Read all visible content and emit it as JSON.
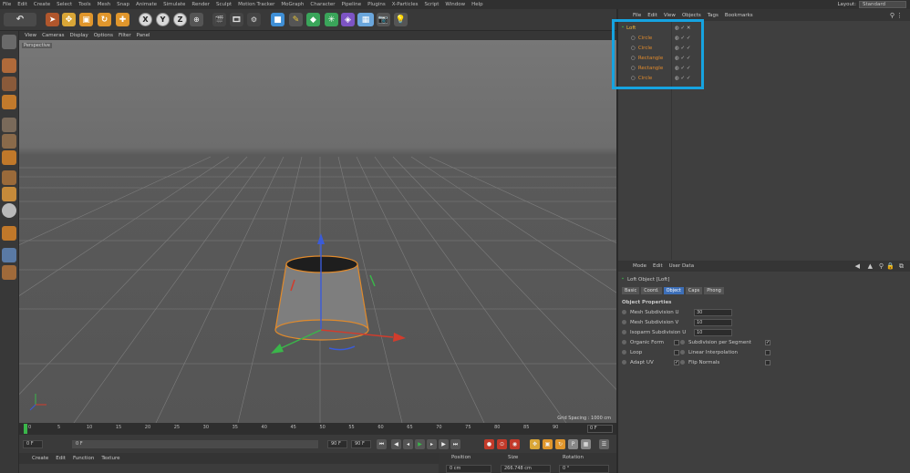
{
  "menubar": {
    "items": [
      "File",
      "Edit",
      "Create",
      "Select",
      "Tools",
      "Mesh",
      "Snap",
      "Animate",
      "Simulate",
      "Render",
      "Sculpt",
      "Motion Tracker",
      "MoGraph",
      "Character",
      "Pipeline",
      "Plugins",
      "X-Particles",
      "Script",
      "Window",
      "Help"
    ]
  },
  "layout": {
    "label": "Layout:",
    "value": "Standard"
  },
  "toolbar": {
    "axis_x": "X",
    "axis_y": "Y",
    "axis_z": "Z"
  },
  "viewport": {
    "menu": [
      "View",
      "Cameras",
      "Display",
      "Options",
      "Filter",
      "Panel"
    ],
    "label": "Perspective",
    "grid_spacing": "Grid Spacing : 1000 cm"
  },
  "timeline": {
    "ticks": [
      "0",
      "5",
      "10",
      "15",
      "20",
      "25",
      "30",
      "35",
      "40",
      "45",
      "50",
      "55",
      "60",
      "65",
      "70",
      "75",
      "80",
      "85",
      "90"
    ],
    "end_frame": "0 F"
  },
  "playback": {
    "start_field": "0 F",
    "current_field": "0 F",
    "end_field": "90 F",
    "end_field2": "90 F"
  },
  "material_menu": [
    "Create",
    "Edit",
    "Function",
    "Texture"
  ],
  "coord_headers": [
    "Position",
    "Size",
    "Rotation"
  ],
  "coord_values": {
    "pos_x": "0 cm",
    "size_x": "266.748 cm",
    "rot_h": "0 °"
  },
  "object_manager": {
    "menu": [
      "File",
      "Edit",
      "View",
      "Objects",
      "Tags",
      "Bookmarks"
    ],
    "objects": [
      {
        "name": "Loft",
        "root": true
      },
      {
        "name": "Circle",
        "root": false
      },
      {
        "name": "Circle",
        "root": false
      },
      {
        "name": "Rectangle",
        "root": false
      },
      {
        "name": "Rectangle",
        "root": false
      },
      {
        "name": "Circle",
        "root": false
      }
    ]
  },
  "attributes": {
    "menu": [
      "Mode",
      "Edit",
      "User Data"
    ],
    "title": "Loft Object [Loft]",
    "tabs": [
      "Basic",
      "Coord.",
      "Object",
      "Caps",
      "Phong"
    ],
    "active_tab": "Object",
    "section": "Object Properties",
    "mesh_u_label": "Mesh Subdivision U",
    "mesh_u": "30",
    "mesh_v_label": "Mesh Subdivision V",
    "mesh_v": "10",
    "isoparm_label": "Isoparm Subdivision U",
    "isoparm": "10",
    "organic_form": "Organic Form",
    "loop": "Loop",
    "adapt_uv": "Adapt UV",
    "sub_per_segment": "Subdivision per Segment",
    "linear_interp": "Linear Interpolation",
    "flip_normals": "Flip Normals",
    "check": "✓"
  },
  "colors": {
    "highlight": "#16a3e0",
    "object_orange": "#e08a2c",
    "active_tab": "#3d6fb8"
  }
}
